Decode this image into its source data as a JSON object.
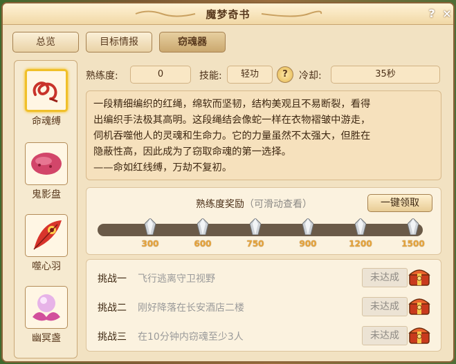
{
  "window": {
    "title": "魔梦奇书",
    "help": "?",
    "close": "×"
  },
  "tabs": [
    {
      "label": "总览"
    },
    {
      "label": "目标情报"
    },
    {
      "label": "窃魂器"
    }
  ],
  "sidebar": {
    "items": [
      {
        "label": "命魂缚",
        "icon": "red-rope-icon"
      },
      {
        "label": "鬼影盘",
        "icon": "pink-stone-icon"
      },
      {
        "label": "噬心羽",
        "icon": "red-feather-icon"
      },
      {
        "label": "幽冥盏",
        "icon": "lotus-orb-icon"
      }
    ]
  },
  "stats": {
    "proficiency_label": "熟练度:",
    "proficiency_value": "0",
    "skill_label": "技能:",
    "skill_value": "轻功",
    "help": "?",
    "cooldown_label": "冷却:",
    "cooldown_value": "35秒"
  },
  "description": {
    "lines": [
      "一段精细编织的红绳，绵软而坚韧，结构美观且不易断裂，看得",
      "出编织手法极其高明。这段绳结会像蛇一样在衣物褶皱中游走，",
      "伺机吞噬他人的灵魂和生命力。它的力量虽然不太强大，但胜在",
      "隐蔽性高，因此成为了窃取命魂的第一选择。",
      "——命如红线缚，万劫不复初。"
    ]
  },
  "reward": {
    "title": "熟练度奖励",
    "hint": "（可滑动查看）",
    "claim_button": "一键领取",
    "progress": 0,
    "milestones": [
      "300",
      "600",
      "750",
      "900",
      "1200",
      "1500"
    ]
  },
  "challenges": [
    {
      "title": "挑战一",
      "desc": "飞行逃离守卫视野",
      "status": "未达成"
    },
    {
      "title": "挑战二",
      "desc": "刚好降落在长安酒店二楼",
      "status": "未达成"
    },
    {
      "title": "挑战三",
      "desc": "在10分钟内窃魂至少3人",
      "status": "未达成"
    }
  ],
  "colors": {
    "accent": "#f0c02a",
    "text": "#3e2812",
    "milestone": "#e7a53c",
    "muted": "#9a9a9a"
  }
}
